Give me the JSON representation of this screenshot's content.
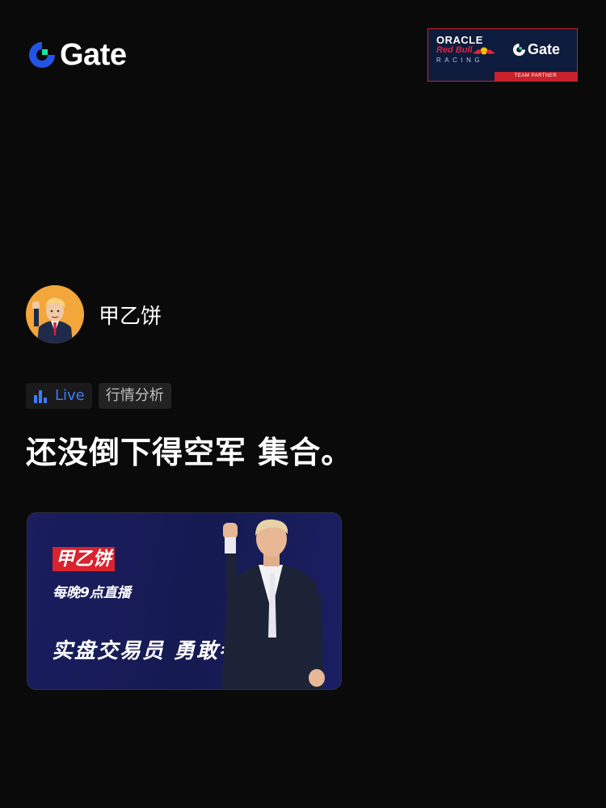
{
  "header": {
    "logo_text": "Gate",
    "partner_badge": {
      "line1": "ORACLE",
      "line2": "Red Bull",
      "line3": "RACING",
      "gate_text": "Gate",
      "strip_text": "TEAM PARTNER"
    }
  },
  "author": {
    "name": "甲乙饼",
    "avatar_icon": "trump-cartoon-avatar"
  },
  "tags": {
    "live_label": "Live",
    "live_icon": "bar-chart-icon",
    "topic_label": "行情分析"
  },
  "post": {
    "text": "还没倒下得空军 集合。"
  },
  "banner": {
    "name": "甲乙饼",
    "subtitle": "每晚9点直播",
    "slogan": "实盘交易员 勇敢者游戏"
  },
  "colors": {
    "background": "#0a0a0a",
    "brand_blue": "#2354e6",
    "brand_green": "#17e6a1",
    "live_blue": "#3d7cff",
    "banner_red": "#d9232e",
    "banner_navy": "#1a1d5e"
  }
}
